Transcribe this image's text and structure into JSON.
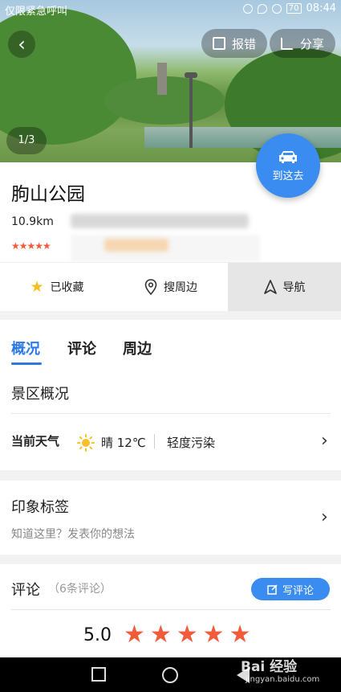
{
  "status_bar": {
    "left_text": "仅限紧急呼叫",
    "time": "08:44",
    "battery": "70"
  },
  "hero": {
    "back_icon": "chevron-left-icon",
    "report_label": "报错",
    "share_label": "分享",
    "photo_counter": "1/3",
    "goto_label": "到这去"
  },
  "place": {
    "name": "朐山公园",
    "distance": "10.9km"
  },
  "actions": {
    "favorite_label": "已收藏",
    "nearby_label": "搜周边",
    "navigate_label": "导航"
  },
  "tabs": [
    {
      "label": "概况"
    },
    {
      "label": "评论"
    },
    {
      "label": "周边"
    }
  ],
  "overview": {
    "heading": "景区概况",
    "weather_label": "当前天气",
    "weather_text": "晴 12℃",
    "air_quality": "轻度污染"
  },
  "impression": {
    "title": "印象标签",
    "hint": "知道这里？发表你的想法"
  },
  "comments": {
    "title": "评论",
    "count": "（6条评论）",
    "write_label": "写评论",
    "score": "5.0",
    "stars": "★★★★★"
  },
  "watermark": {
    "brand": "Bai 经验",
    "url": "jingyan.baidu.com"
  },
  "colors": {
    "accent": "#3b8cf0",
    "star": "#f25a3c",
    "favorite_star": "#f4c021"
  }
}
